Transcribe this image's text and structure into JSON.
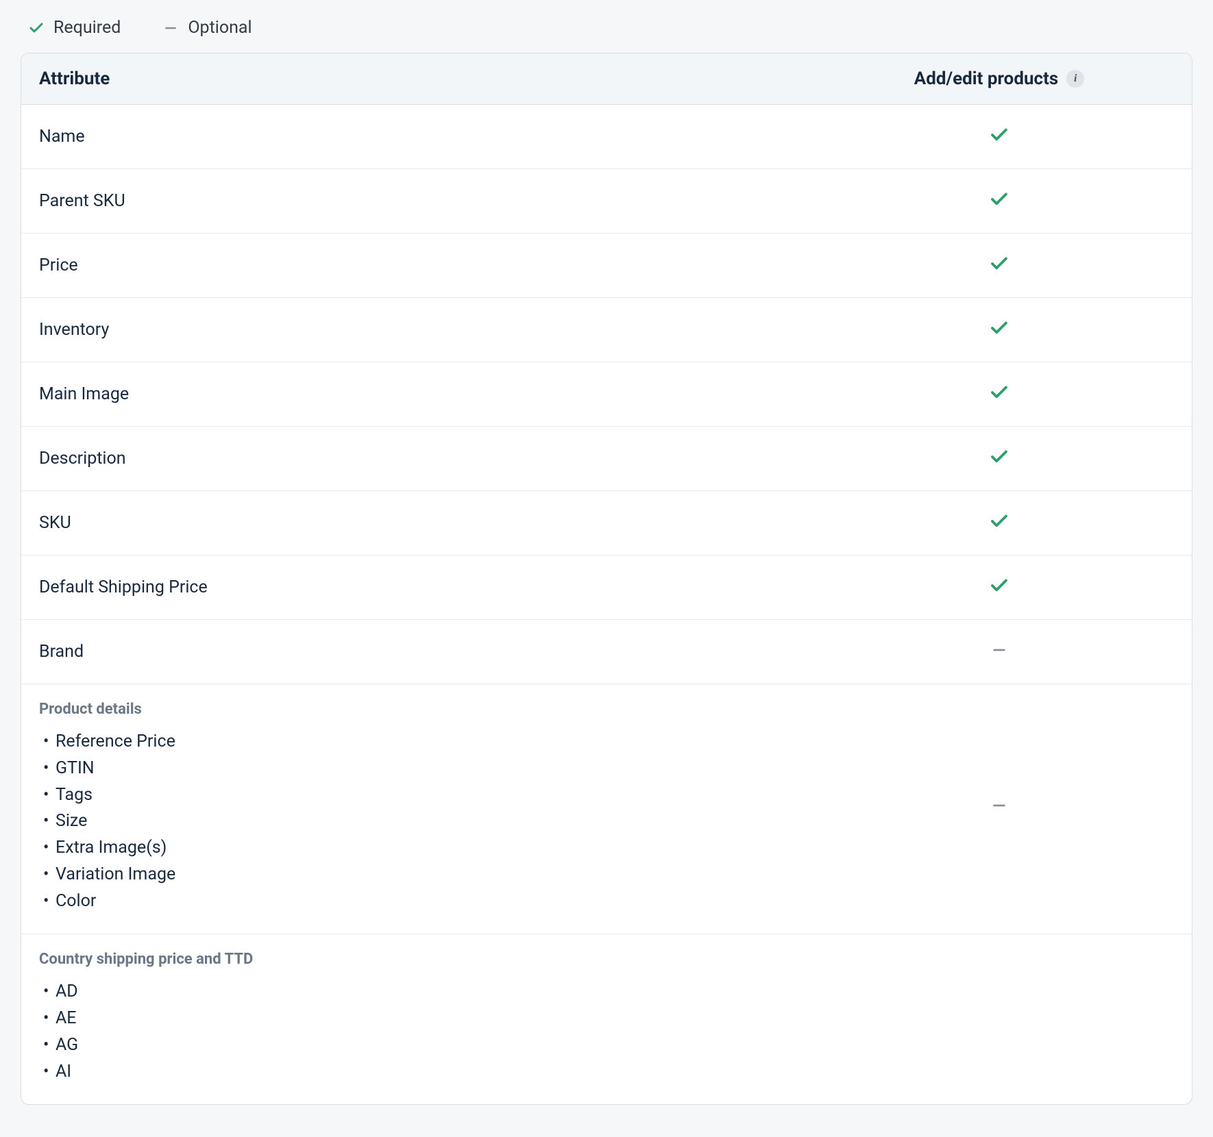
{
  "legend": {
    "required": "Required",
    "optional": "Optional"
  },
  "colors": {
    "check": "#2e9e6b",
    "dash": "#8a9099"
  },
  "table": {
    "headers": {
      "attribute": "Attribute",
      "status": "Add/edit products"
    },
    "rows": [
      {
        "label": "Name",
        "status": "required"
      },
      {
        "label": "Parent SKU",
        "status": "required"
      },
      {
        "label": "Price",
        "status": "required"
      },
      {
        "label": "Inventory",
        "status": "required"
      },
      {
        "label": "Main Image",
        "status": "required"
      },
      {
        "label": "Description",
        "status": "required"
      },
      {
        "label": "SKU",
        "status": "required"
      },
      {
        "label": "Default Shipping Price",
        "status": "required"
      },
      {
        "label": "Brand",
        "status": "optional"
      }
    ],
    "sections": [
      {
        "title": "Product details",
        "items": [
          "Reference Price",
          "GTIN",
          "Tags",
          "Size",
          "Extra Image(s)",
          "Variation Image",
          "Color"
        ],
        "status": "optional"
      },
      {
        "title": "Country shipping price and TTD",
        "items": [
          "AD",
          "AE",
          "AG",
          "AI"
        ],
        "status": "optional",
        "show_status": false
      }
    ]
  }
}
